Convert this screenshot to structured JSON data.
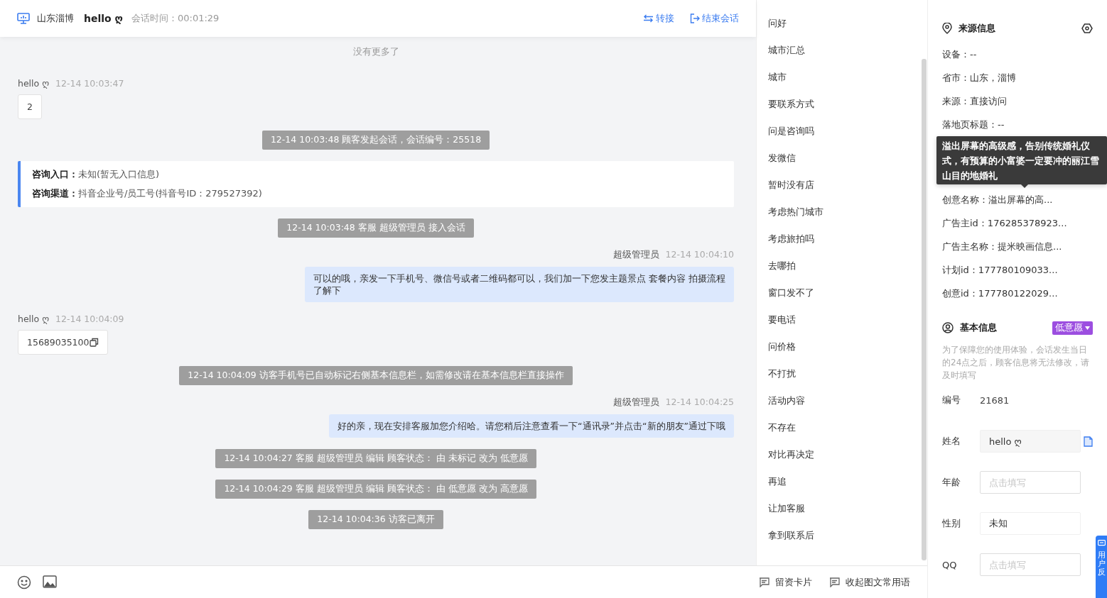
{
  "header": {
    "location": "山东淄博",
    "visitor": "hello ღ",
    "duration": "会话时间：00:01:29",
    "actions": [
      {
        "kind": "transfer",
        "label": "转接"
      },
      {
        "kind": "end",
        "label": "结束会话"
      }
    ]
  },
  "messages": [
    {
      "kind": "notice",
      "text": "没有更多了"
    },
    {
      "kind": "visitor",
      "name": "hello ღ",
      "time": "12-14 10:03:47",
      "text": "2",
      "copyable": false
    },
    {
      "kind": "system",
      "text": "12-14 10:03:48 顾客发起会话，会话编号：25518"
    },
    {
      "kind": "entry",
      "rows": [
        {
          "label": "咨询入口：",
          "value": "未知(暂无入口信息)"
        },
        {
          "label": "咨询渠道：",
          "value": "抖音企业号/员工号(抖音号ID：279527392)"
        }
      ]
    },
    {
      "kind": "system",
      "text": "12-14 10:03:48 客服 超级管理员 接入会话"
    },
    {
      "kind": "agent",
      "name": "超级管理员",
      "time": "12-14 10:04:10",
      "text": "可以的哦，亲发一下手机号、微信号或者二维码都可以，我们加一下您发主题景点 套餐内容 拍摄流程了解下"
    },
    {
      "kind": "visitor",
      "name": "hello ღ",
      "time": "12-14 10:04:09",
      "text": "15689035100",
      "copyable": true
    },
    {
      "kind": "system",
      "text": "12-14 10:04:09 访客手机号已自动标记右侧基本信息栏，如需修改请在基本信息栏直接操作"
    },
    {
      "kind": "agent",
      "name": "超级管理员",
      "time": "12-14 10:04:25",
      "text": "好的亲，现在安排客服加您介绍哈。请您稍后注意查看一下“通讯录”并点击“新的朋友”通过下哦"
    },
    {
      "kind": "system",
      "text": "12-14 10:04:27 客服 超级管理员 编辑 顾客状态： 由 未标记 改为 低意愿"
    },
    {
      "kind": "system",
      "text": "12-14 10:04:29 客服 超级管理员 编辑 顾客状态： 由 低意愿 改为 高意愿"
    },
    {
      "kind": "system",
      "text": "12-14 10:04:36 访客已离开"
    }
  ],
  "quick_replies": [
    "问好",
    "城市汇总",
    "城市",
    "要联系方式",
    "问是咨询吗",
    "发微信",
    "暂时没有店",
    "考虑热门城市",
    "考虑旅拍吗",
    "去哪拍",
    "窗口发不了",
    "要电话",
    "问价格",
    "不打扰",
    "活动内容",
    "不存在",
    "对比再决定",
    "再追",
    "让加客服",
    "拿到联系后"
  ],
  "toolbar": {
    "tools": [
      {
        "kind": "emoji"
      },
      {
        "kind": "image"
      }
    ],
    "actions": [
      {
        "label": "留资卡片"
      },
      {
        "label": "收起图文常用语"
      }
    ]
  },
  "source_info": {
    "title": "来源信息",
    "items": [
      {
        "kind": "row",
        "text": "设备：--"
      },
      {
        "kind": "row",
        "text": "省市：山东，淄博"
      },
      {
        "kind": "row",
        "text": "来源：直接访问"
      },
      {
        "kind": "row",
        "text": "落地页标题：--"
      },
      {
        "kind": "tooltip",
        "text": "溢出屏幕的高级感，告别传统婚礼仪式，有预算的小富婆一定要冲的丽江雪山目的地婚礼"
      },
      {
        "kind": "row",
        "text": "创意名称：溢出屏幕的高..."
      },
      {
        "kind": "row",
        "text": "广告主id：176285378923..."
      },
      {
        "kind": "row",
        "text": "广告主名称：提米映画信息..."
      },
      {
        "kind": "row",
        "text": "计划id：177780109033..."
      },
      {
        "kind": "row",
        "text": "创意id：177780122029..."
      }
    ]
  },
  "basic_info": {
    "title": "基本信息",
    "intent": {
      "label": "低意愿",
      "color": "#9c4ee0"
    },
    "notice": "为了保障您的使用体验，会话发生当日的24点之后，顾客信息将无法修改，请及时填写",
    "fields": [
      {
        "kind": "text",
        "label": "编号",
        "value": "21681"
      },
      {
        "kind": "readonly",
        "label": "姓名",
        "value": "hello ღ",
        "copyable": true
      },
      {
        "kind": "input",
        "label": "年龄",
        "placeholder": "点击填写"
      },
      {
        "kind": "select",
        "label": "性别",
        "value": "未知"
      },
      {
        "kind": "input",
        "label": "QQ",
        "placeholder": "点击填写"
      }
    ]
  },
  "feedback_tab": {
    "label": "用户反"
  }
}
